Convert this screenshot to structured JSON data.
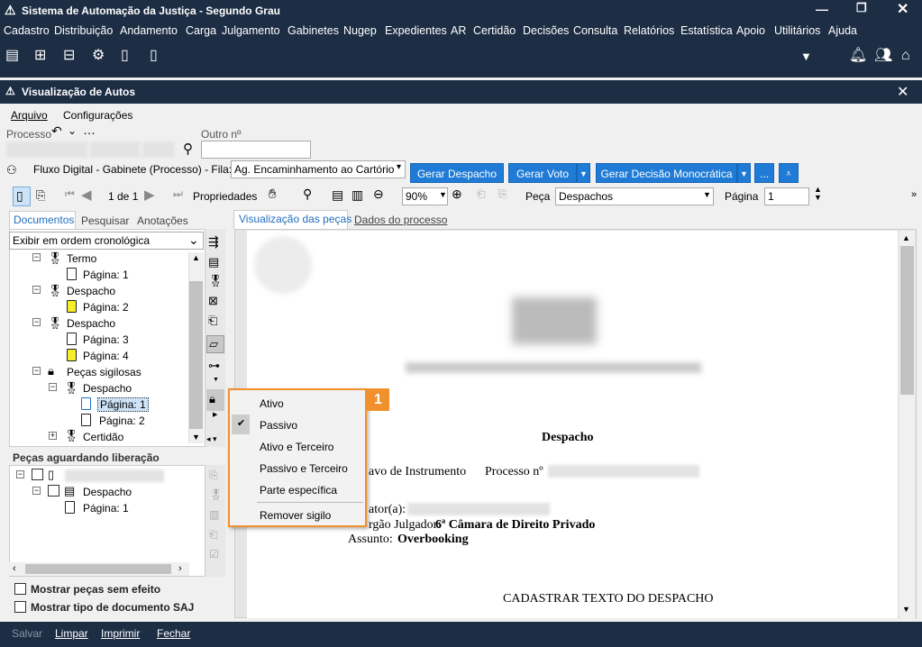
{
  "window": {
    "title": "Sistema de Automação da Justiça - Segundo Grau"
  },
  "menubar": [
    "Cadastro",
    "Distribuição",
    "Andamento",
    "Carga",
    "Julgamento",
    "Gabinetes",
    "Nugep",
    "Expedientes",
    "AR",
    "Certidão",
    "Decisões",
    "Consulta",
    "Relatórios",
    "Estatística",
    "Apoio",
    "Utilitários",
    "Ajuda"
  ],
  "subwindow": {
    "title": "Visualização de Autos"
  },
  "filemenu": {
    "arquivo": "Arquivo",
    "config": "Configurações"
  },
  "processo": {
    "label": "Processo",
    "outro_label": "Outro nº"
  },
  "fluxo": {
    "label": "Fluxo Digital - Gabinete (Processo) - Fila:",
    "fila_value": "Ag. Encaminhamento ao Cartório",
    "btn_despacho": "Gerar Despacho",
    "btn_voto": "Gerar Voto",
    "btn_decisao": "Gerar Decisão Monocrática",
    "btn_more": "..."
  },
  "viewer_toolbar": {
    "page_of": "1 de 1",
    "propriedades": "Propriedades",
    "zoom": "90%",
    "peca_label": "Peça",
    "peca_value": "Despachos",
    "pagina_label": "Página",
    "pagina_value": "1"
  },
  "left_tabs": {
    "documentos": "Documentos",
    "pesquisar": "Pesquisar",
    "anotacoes": "Anotações"
  },
  "order_select": "Exibir em ordem cronológica",
  "tree": {
    "termo": "Termo",
    "pagina1": "Página: 1",
    "despacho": "Despacho",
    "pagina2": "Página: 2",
    "pagina3": "Página: 3",
    "pagina4": "Página: 4",
    "pecas_sigilosas": "Peças sigilosas",
    "certidao": "Certidão"
  },
  "liberacao": {
    "title": "Peças aguardando liberação",
    "despacho": "Despacho",
    "pagina": "Página: 1"
  },
  "checks": {
    "sem_efeito": "Mostrar peças sem efeito",
    "tipo_saj": "Mostrar tipo de documento SAJ"
  },
  "right_tabs": {
    "visualizacao": "Visualização das peças",
    "dados": "Dados do processo"
  },
  "context_menu": {
    "items": [
      "Ativo",
      "Passivo",
      "Ativo e Terceiro",
      "Passivo e Terceiro",
      "Parte específica",
      "Remover sigilo"
    ],
    "checked": "Passivo",
    "badge": "1"
  },
  "document": {
    "title": "Despacho",
    "line1a": "avo de Instrumento",
    "line1b": "Processo nº",
    "relator": "ator(a):",
    "orgao_label": "rgão Julgador:",
    "orgao_value": "6ª Câmara de Direito Privado",
    "assunto_label": "Assunto:",
    "assunto_value": "Overbooking",
    "footer": "CADASTRAR TEXTO DO DESPACHO"
  },
  "status": {
    "salvar": "Salvar",
    "limpar": "Limpar",
    "imprimir": "Imprimir",
    "fechar": "Fechar"
  },
  "colors": {
    "navy": "#1d2d44",
    "blue": "#1f7bd6",
    "orange": "#f0912d",
    "highlight": "#cde3f7"
  }
}
